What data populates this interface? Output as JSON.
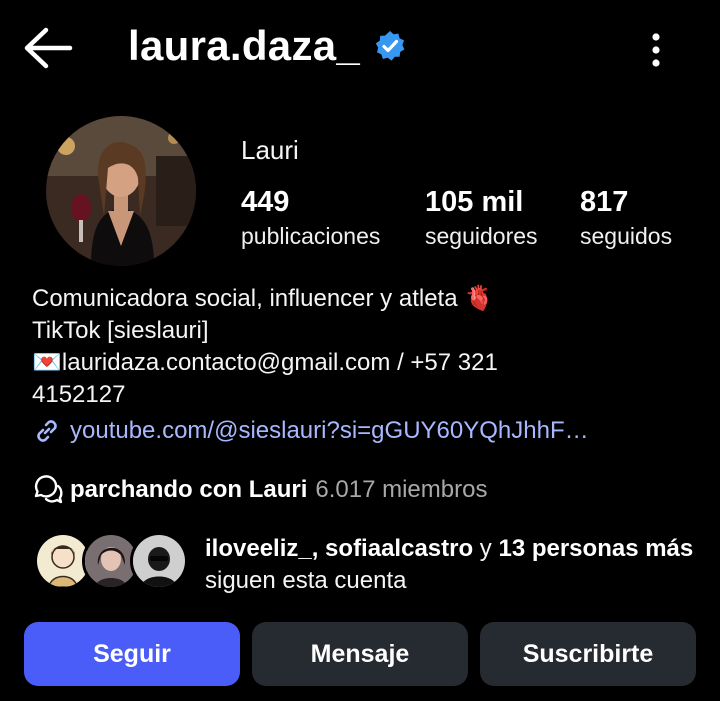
{
  "header": {
    "username": "laura.daza_",
    "back_icon": "arrow-left-icon",
    "verified_icon": "verified-badge-icon",
    "more_icon": "more-vertical-icon"
  },
  "profile": {
    "display_name": "Lauri",
    "stats": {
      "posts_count": "449",
      "posts_label": "publicaciones",
      "followers_count": "105 mil",
      "followers_label": "seguidores",
      "following_count": "817",
      "following_label": "seguidos"
    }
  },
  "bio": {
    "line1": "Comunicadora social, influencer y atleta 🫀",
    "line2": "TikTok [sieslauri]",
    "line3": "💌lauridaza.contacto@gmail.com / +57 321",
    "line4": "4152127",
    "link": "youtube.com/@sieslauri?si=gGUY60YQhJhhF…"
  },
  "channel": {
    "name": "parchando con Lauri",
    "members": "6.017 miembros"
  },
  "mutuals": {
    "names": "iloveeliz_, sofiaalcastro",
    "connector": " y ",
    "others": "13 personas más",
    "suffix": " siguen esta cuenta"
  },
  "actions": {
    "follow": "Seguir",
    "message": "Mensaje",
    "subscribe": "Suscribirte"
  },
  "colors": {
    "background": "#000000",
    "primary_button": "#4a5df9",
    "secondary_button": "#262a31",
    "link": "#a8b8ff",
    "verified": "#3897f0",
    "muted_text": "#a8a8a8"
  }
}
